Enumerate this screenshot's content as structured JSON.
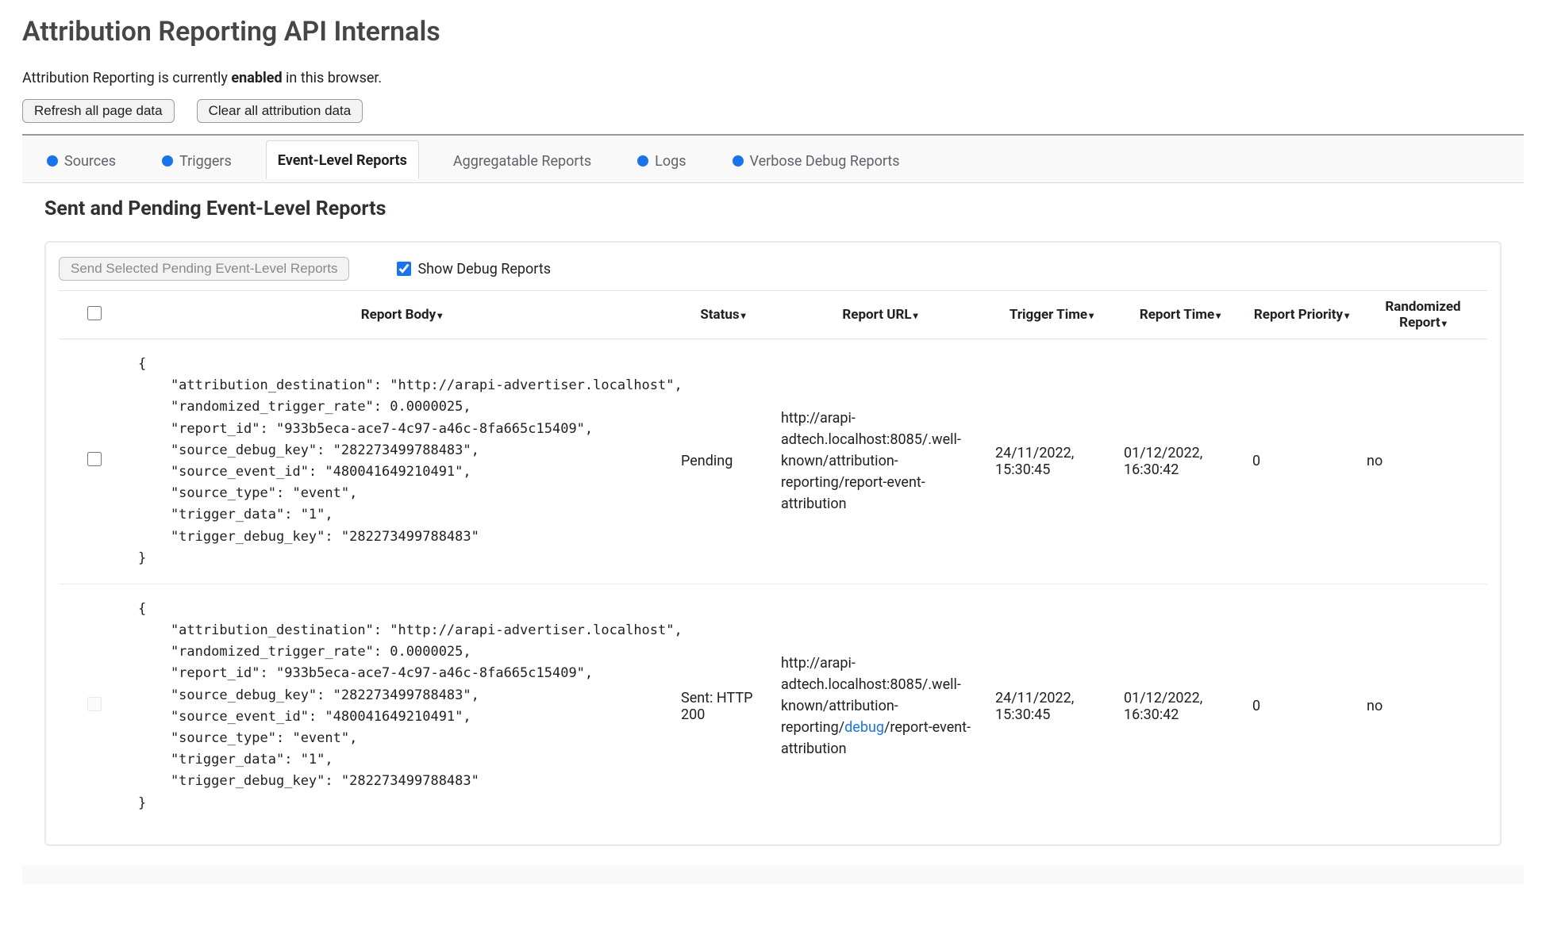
{
  "page": {
    "title": "Attribution Reporting API Internals",
    "status_prefix": "Attribution Reporting is currently ",
    "status_enabled_word": "enabled",
    "status_suffix": " in this browser."
  },
  "buttons": {
    "refresh": "Refresh all page data",
    "clear_all": "Clear all attribution data",
    "send_selected": "Send Selected Pending Event-Level Reports"
  },
  "tabs": {
    "sources": "Sources",
    "triggers": "Triggers",
    "event_level": "Event-Level Reports",
    "aggregatable": "Aggregatable Reports",
    "logs": "Logs",
    "verbose_debug": "Verbose Debug Reports",
    "active": "event_level"
  },
  "section": {
    "heading": "Sent and Pending Event-Level Reports",
    "show_debug_label": "Show Debug Reports",
    "show_debug_checked": true
  },
  "table": {
    "headers": {
      "report_body": "Report Body",
      "status": "Status",
      "report_url": "Report URL",
      "trigger_time": "Trigger Time",
      "report_time": "Report Time",
      "report_priority": "Report Priority",
      "randomized_report": "Randomized Report"
    },
    "rows": [
      {
        "selectable": true,
        "body_json": "{\n    \"attribution_destination\": \"http://arapi-advertiser.localhost\",\n    \"randomized_trigger_rate\": 0.0000025,\n    \"report_id\": \"933b5eca-ace7-4c97-a46c-8fa665c15409\",\n    \"source_debug_key\": \"282273499788483\",\n    \"source_event_id\": \"480041649210491\",\n    \"source_type\": \"event\",\n    \"trigger_data\": \"1\",\n    \"trigger_debug_key\": \"282273499788483\"\n}",
        "status": "Pending",
        "url_prefix": "http://arapi-adtech.localhost:8085/.well-known/attribution-reporting/",
        "url_debug_word": "",
        "url_suffix": "report-event-attribution",
        "trigger_time": "24/11/2022, 15:30:45",
        "report_time": "01/12/2022, 16:30:42",
        "priority": "0",
        "randomized": "no"
      },
      {
        "selectable": false,
        "body_json": "{\n    \"attribution_destination\": \"http://arapi-advertiser.localhost\",\n    \"randomized_trigger_rate\": 0.0000025,\n    \"report_id\": \"933b5eca-ace7-4c97-a46c-8fa665c15409\",\n    \"source_debug_key\": \"282273499788483\",\n    \"source_event_id\": \"480041649210491\",\n    \"source_type\": \"event\",\n    \"trigger_data\": \"1\",\n    \"trigger_debug_key\": \"282273499788483\"\n}",
        "status": "Sent: HTTP 200",
        "url_prefix": "http://arapi-adtech.localhost:8085/.well-known/attribution-reporting/",
        "url_debug_word": "debug",
        "url_suffix": "/report-event-attribution",
        "trigger_time": "24/11/2022, 15:30:45",
        "report_time": "01/12/2022, 16:30:42",
        "priority": "0",
        "randomized": "no"
      }
    ]
  }
}
